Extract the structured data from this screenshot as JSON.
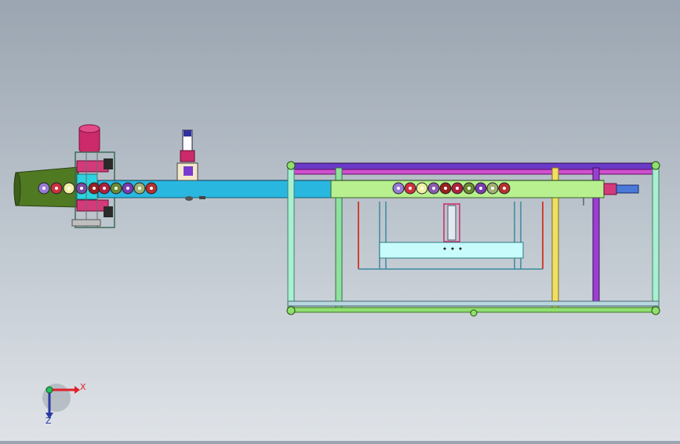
{
  "view": {
    "title": "",
    "background_top": "#9aa5b1",
    "background_bottom": "#dfe3e8"
  },
  "triad": {
    "x_label": "X",
    "z_label": "Z",
    "x_color": "#e0202a",
    "y_color": "#22c05a",
    "z_color": "#2a3aa0"
  },
  "colors": {
    "motor": "#cc2a6a",
    "conveyor": "#29b7e0",
    "frame_rail": "#7a3ad0",
    "frame_leg": "#a8f0d0",
    "bracket": "#b8f090",
    "hopper": "#4f7a22",
    "frame_base": "#90e070",
    "yellow_post": "#f0e060",
    "purple_post": "#9a3fd0",
    "plate": "#c8fbfb"
  }
}
